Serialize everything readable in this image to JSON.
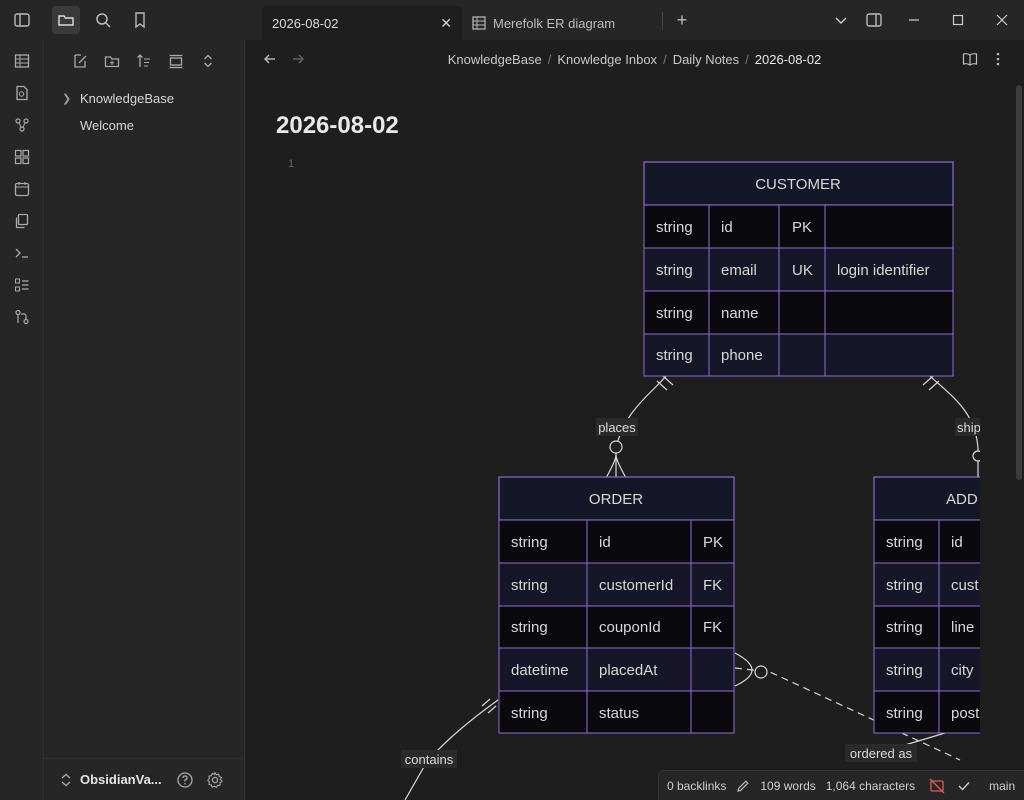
{
  "tabs": [
    {
      "label": "2026-08-02",
      "active": true
    },
    {
      "label": "Merefolk ER diagram",
      "active": false
    }
  ],
  "breadcrumb": [
    "KnowledgeBase",
    "Knowledge Inbox",
    "Daily Notes",
    "2026-08-02"
  ],
  "sidebar": {
    "items": [
      {
        "label": "KnowledgeBase",
        "type": "folder"
      },
      {
        "label": "Welcome",
        "type": "file"
      }
    ],
    "vault_name": "ObsidianVa..."
  },
  "note": {
    "title": "2026-08-02",
    "line_number": "1"
  },
  "diagram": {
    "entities": {
      "customer": {
        "name": "CUSTOMER",
        "rows": [
          [
            "string",
            "id",
            "PK",
            ""
          ],
          [
            "string",
            "email",
            "UK",
            "login identifier"
          ],
          [
            "string",
            "name",
            "",
            ""
          ],
          [
            "string",
            "phone",
            "",
            ""
          ]
        ]
      },
      "order": {
        "name": "ORDER",
        "rows": [
          [
            "string",
            "id",
            "PK"
          ],
          [
            "string",
            "customerId",
            "FK"
          ],
          [
            "string",
            "couponId",
            "FK"
          ],
          [
            "datetime",
            "placedAt",
            ""
          ],
          [
            "string",
            "status",
            ""
          ]
        ]
      },
      "address": {
        "name": "ADD",
        "rows": [
          [
            "string",
            "id"
          ],
          [
            "string",
            "cust"
          ],
          [
            "string",
            "line"
          ],
          [
            "string",
            "city"
          ],
          [
            "string",
            "post"
          ]
        ]
      }
    },
    "relationships": {
      "places": "places",
      "ships": "ship",
      "contains": "contains",
      "ordered_as": "ordered as"
    }
  },
  "status": {
    "backlinks": "0 backlinks",
    "words": "109 words",
    "characters": "1,064 characters",
    "branch": "main"
  },
  "colors": {
    "entity_header": "#161629",
    "entity_border": "#8c6fd6",
    "row_dark": "#0a0a0e",
    "row_alt": "#161628"
  }
}
